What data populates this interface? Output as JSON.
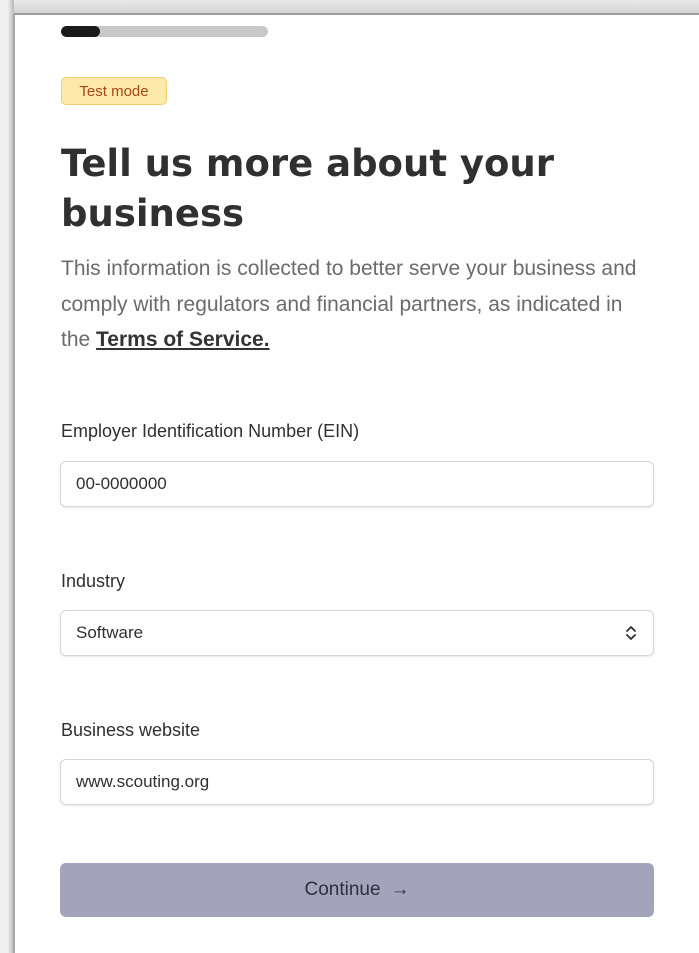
{
  "onboarding": {
    "progress_fraction": 0.19,
    "badge": "Test mode",
    "title": "Tell us more about your business",
    "description": {
      "text": "This information is collected to better serve your business and comply with regulators and financial partners, as indicated in the ",
      "link_text": "Terms of Service."
    },
    "fields": {
      "ein": {
        "label": "Employer Identification Number (EIN)",
        "value": "00-0000000"
      },
      "industry": {
        "label": "Industry",
        "selected": "Software"
      },
      "website": {
        "label": "Business website",
        "value": "www.scouting.org"
      }
    },
    "continue_label": "Continue",
    "continue_icon": "arrow-right-icon",
    "colors": {
      "button_bg": "#a3a3bc",
      "badge_bg": "#fde9a9",
      "badge_text": "#a3471c",
      "progress_fill": "#1a1a1a"
    }
  }
}
